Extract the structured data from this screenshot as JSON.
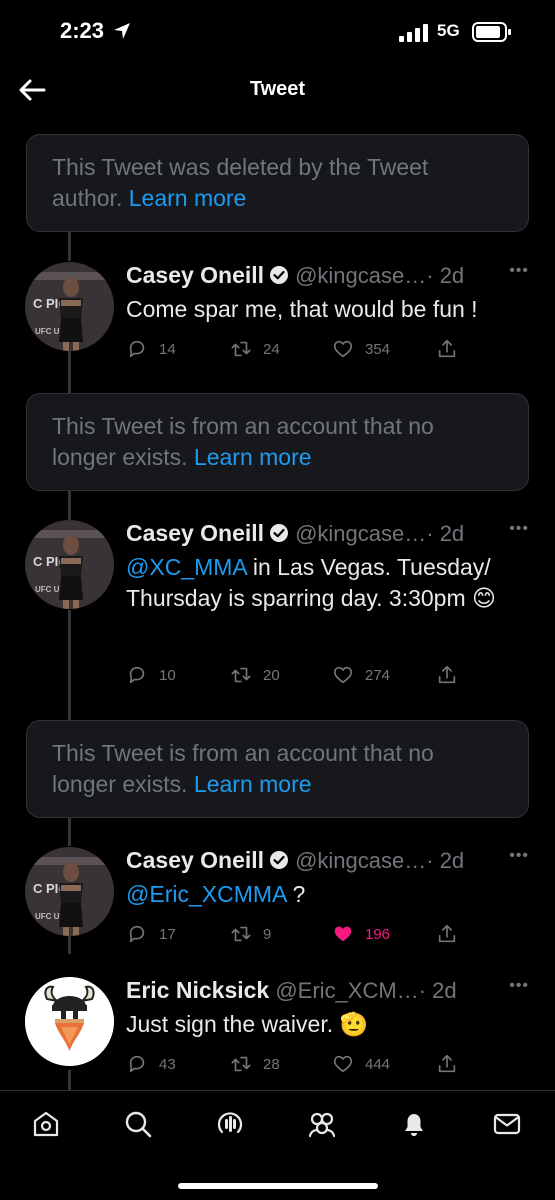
{
  "status_bar": {
    "time": "2:23",
    "network": "5G"
  },
  "header": {
    "title": "Tweet"
  },
  "notices": [
    {
      "text": "This Tweet was deleted by the Tweet author.",
      "link": "Learn more"
    },
    {
      "text": "This Tweet is from an account that no longer exists.",
      "link": "Learn more"
    },
    {
      "text": "This Tweet is from an account that no longer exists.",
      "link": "Learn more"
    }
  ],
  "tweets": [
    {
      "name": "Casey Oneill",
      "handle": "@kingcase…",
      "time": "· 2d",
      "mention": "",
      "body": "Come spar me, that would be fun !",
      "replies": "14",
      "retweets": "24",
      "likes": "354"
    },
    {
      "name": "Casey Oneill",
      "handle": "@kingcase…",
      "time": "· 2d",
      "mention": "@XC_MMA",
      "body": " in Las Vegas. Tuesday/ Thursday is sparring day. 3:30pm 😊",
      "replies": "10",
      "retweets": "20",
      "likes": "274"
    },
    {
      "name": "Casey Oneill",
      "handle": "@kingcase…",
      "time": "· 2d",
      "mention": "@Eric_XCMMA",
      "body": " ?",
      "replies": "17",
      "retweets": "9",
      "likes": "196",
      "liked": true
    },
    {
      "name": "Eric Nicksick",
      "handle": "@Eric_XCM…",
      "time": "· 2d",
      "mention": "",
      "body": "Just sign the waiver. 🫡",
      "replies": "43",
      "retweets": "28",
      "likes": "444"
    }
  ],
  "icons": {
    "verified": "verified-badge-icon",
    "reply": "reply-icon",
    "retweet": "retweet-icon",
    "like": "like-icon",
    "share": "share-icon",
    "tabs": [
      "home-icon",
      "search-icon",
      "spaces-icon",
      "communities-icon",
      "notifications-icon",
      "messages-icon"
    ]
  },
  "colors": {
    "background": "#000000",
    "accent": "#1d9bf0",
    "like": "#f91880",
    "muted": "#71767b",
    "card": "#16181c"
  }
}
